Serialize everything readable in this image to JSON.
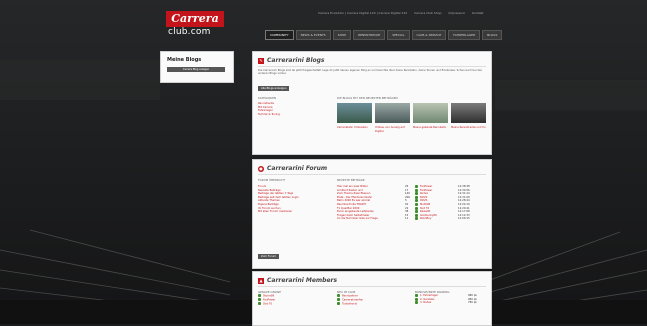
{
  "logo": {
    "brand": "Carrera",
    "sub": "club.com"
  },
  "topnav": [
    "Carrera Evolution | Carrera Digital 124 | Carrera Digital 132",
    "Carrera Club Shop",
    "Impressum",
    "Kontakt"
  ],
  "mainnav": [
    {
      "label": "COMMUNITY",
      "active": true
    },
    {
      "label": "NEWS & EVENTS"
    },
    {
      "label": "SHOP"
    },
    {
      "label": "RENNSTRECKE"
    },
    {
      "label": "SPECIAL"
    },
    {
      "label": "CLUB & SERVICE"
    },
    {
      "label": "FAHRERLAGER"
    },
    {
      "label": "BLOGS"
    }
  ],
  "sidebar": {
    "title": "Meine Blogs",
    "button": "Carrera Blog anlegen"
  },
  "blogs": {
    "title": "Carrerarini Blogs",
    "intro": "Die Carrerarini Blogs sind ab jetzt freigeschaltet! Lege dir jetzt deinen eigenen Blog an und berichte über deine Rennbahn, deine Touren und Erlebnisse. Schau auch bei den anderen Blogs vorbei.",
    "button": "Alle Blogs anzeigen",
    "categories_label": "KATEGORIEN",
    "categories": [
      "Rennstrecke",
      "Mit Carrera",
      "Fahrerlager",
      "Technik & Tuning"
    ],
    "recent_label": "DIE BLOGS MIT DEN NEUESTEN BEITRÄGEN",
    "recent": [
      "Carrerabahn Umbauten",
      "Umbau von Analog auf Digital",
      "Meine gebaute Rennbahn",
      "Meine Rennstrecke und Co"
    ]
  },
  "forum": {
    "title": "Carrerarini Forum",
    "left_label": "FORUM ÜBERSICHT",
    "left_items": [
      "Forum",
      "Neueste Beiträge",
      "Beiträge der letzten 7 Tage",
      "Beiträge seit dem letzten Login",
      "Aktivste Themen",
      "Eigene Beiträge",
      "Im Forum suchen",
      "Mit allen Forum markieren"
    ],
    "button": "Zum Forum",
    "right_label": "NEUESTE BEITRÄGE",
    "posts": [
      {
        "title": "Hier mal ein paar Bilder",
        "n": "25",
        "user": "FanPower",
        "time": "12:38:38"
      },
      {
        "title": "Limitiert Zaster und",
        "n": "17",
        "user": "FanPower",
        "time": "12:34:56"
      },
      {
        "title": "Zum Thema Zwei Ebenen",
        "n": "140",
        "user": "Rodex",
        "time": "12:31:24"
      },
      {
        "title": "Elsta - Der Pferderennbahn",
        "n": "206",
        "user": "ROVK",
        "time": "12:31:00"
      },
      {
        "title": "Bahn 2020 Es war einmal",
        "n": "5",
        "user": "ROVK",
        "time": "12:28:44"
      },
      {
        "title": "Raumkontrolle TRAINT",
        "n": "91",
        "user": "MultiGB",
        "time": "12:24:19"
      },
      {
        "title": "F1 Qualifier 2009",
        "n": "22",
        "user": "Slot 70",
        "time": "12:20:41"
      },
      {
        "title": "Eurer eingebaute Leitplanke",
        "n": "38",
        "user": "Rasle90",
        "time": "12:17:08"
      },
      {
        "title": "Fragen beim Selbstmaler",
        "n": "15",
        "user": "GoldLucky69",
        "time": "12:12:33"
      },
      {
        "title": "An die Techniker Glas zur Frage",
        "n": "11",
        "user": "RoboBoy",
        "time": "12:09:15"
      }
    ]
  },
  "members": {
    "title": "Carrerarini Members",
    "col1_label": "GERADE ONLINE",
    "col1": [
      "Sturm89",
      "FanPower",
      "Slot 70"
    ],
    "col2_label": "NEU IM CLUB",
    "col2": [
      "Rennbahner",
      "Cameratorenfan",
      "Turbothorst"
    ],
    "col3_label": "BONUSPUNKTE RANKING",
    "col3": [
      {
        "name": "1. Fahrerlager",
        "pts": "980 pk"
      },
      {
        "name": "2. Ganzwei",
        "pts": "960 pk"
      },
      {
        "name": "3. Rodex",
        "pts": "780 pk"
      }
    ]
  }
}
